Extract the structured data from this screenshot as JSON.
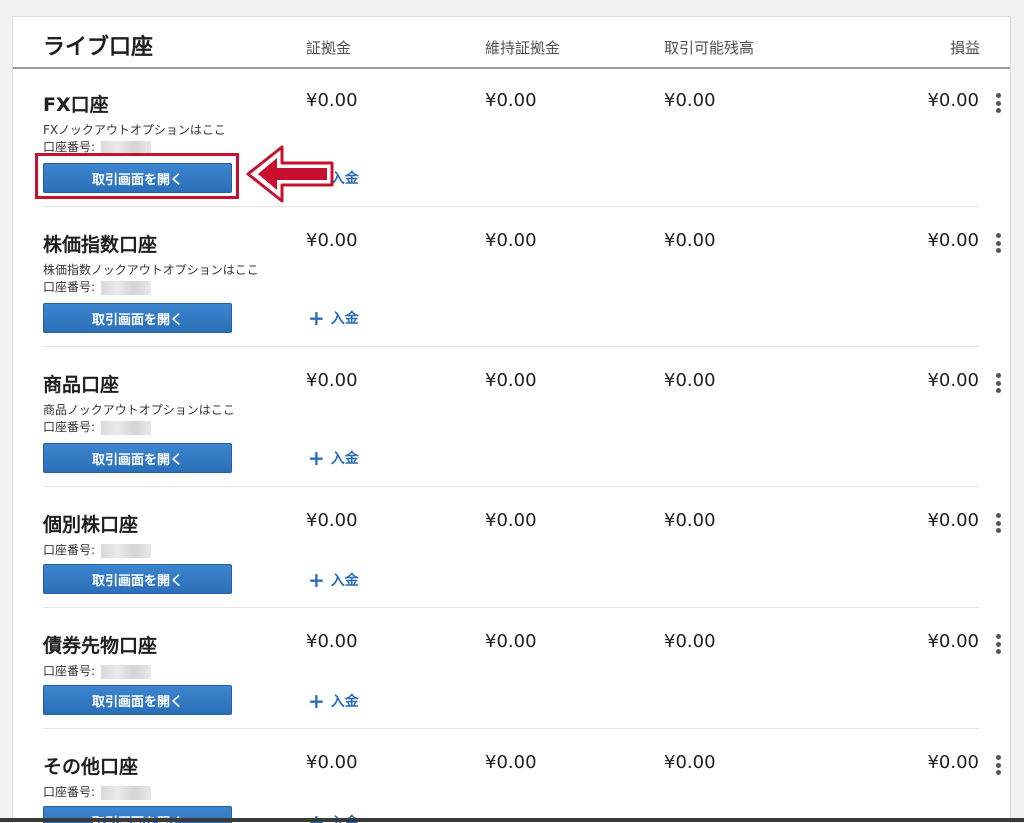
{
  "header": {
    "title": "ライブ口座",
    "columns": [
      "証拠金",
      "維持証拠金",
      "取引可能残高",
      "損益"
    ]
  },
  "accounts": [
    {
      "name": "FX口座",
      "values": [
        "¥0.00",
        "¥0.00",
        "¥0.00",
        "¥0.00"
      ],
      "description": "FXノックアウトオプションはここ",
      "account_label": "口座番号:",
      "open_button": "取引画面を開く",
      "deposit": "入金"
    },
    {
      "name": "株価指数口座",
      "values": [
        "¥0.00",
        "¥0.00",
        "¥0.00",
        "¥0.00"
      ],
      "description": "株価指数ノックアウトオプションはここ",
      "account_label": "口座番号:",
      "open_button": "取引画面を開く",
      "deposit": "入金"
    },
    {
      "name": "商品口座",
      "values": [
        "¥0.00",
        "¥0.00",
        "¥0.00",
        "¥0.00"
      ],
      "description": "商品ノックアウトオプションはここ",
      "account_label": "口座番号:",
      "open_button": "取引画面を開く",
      "deposit": "入金"
    },
    {
      "name": "個別株口座",
      "values": [
        "¥0.00",
        "¥0.00",
        "¥0.00",
        "¥0.00"
      ],
      "account_label": "口座番号:",
      "open_button": "取引画面を開く",
      "deposit": "入金"
    },
    {
      "name": "債券先物口座",
      "values": [
        "¥0.00",
        "¥0.00",
        "¥0.00",
        "¥0.00"
      ],
      "account_label": "口座番号:",
      "open_button": "取引画面を開く",
      "deposit": "入金"
    },
    {
      "name": "その他口座",
      "values": [
        "¥0.00",
        "¥0.00",
        "¥0.00",
        "¥0.00"
      ],
      "account_label": "口座番号:",
      "open_button": "取引画面を開く",
      "deposit": "入金"
    }
  ],
  "colors": {
    "accent": "#2b6db4",
    "button": "#3478c4",
    "highlight": "#c8102e"
  },
  "icons": {
    "more": "kebab-menu-icon",
    "deposit": "plus-icon",
    "annotation": "arrow-left-icon"
  }
}
